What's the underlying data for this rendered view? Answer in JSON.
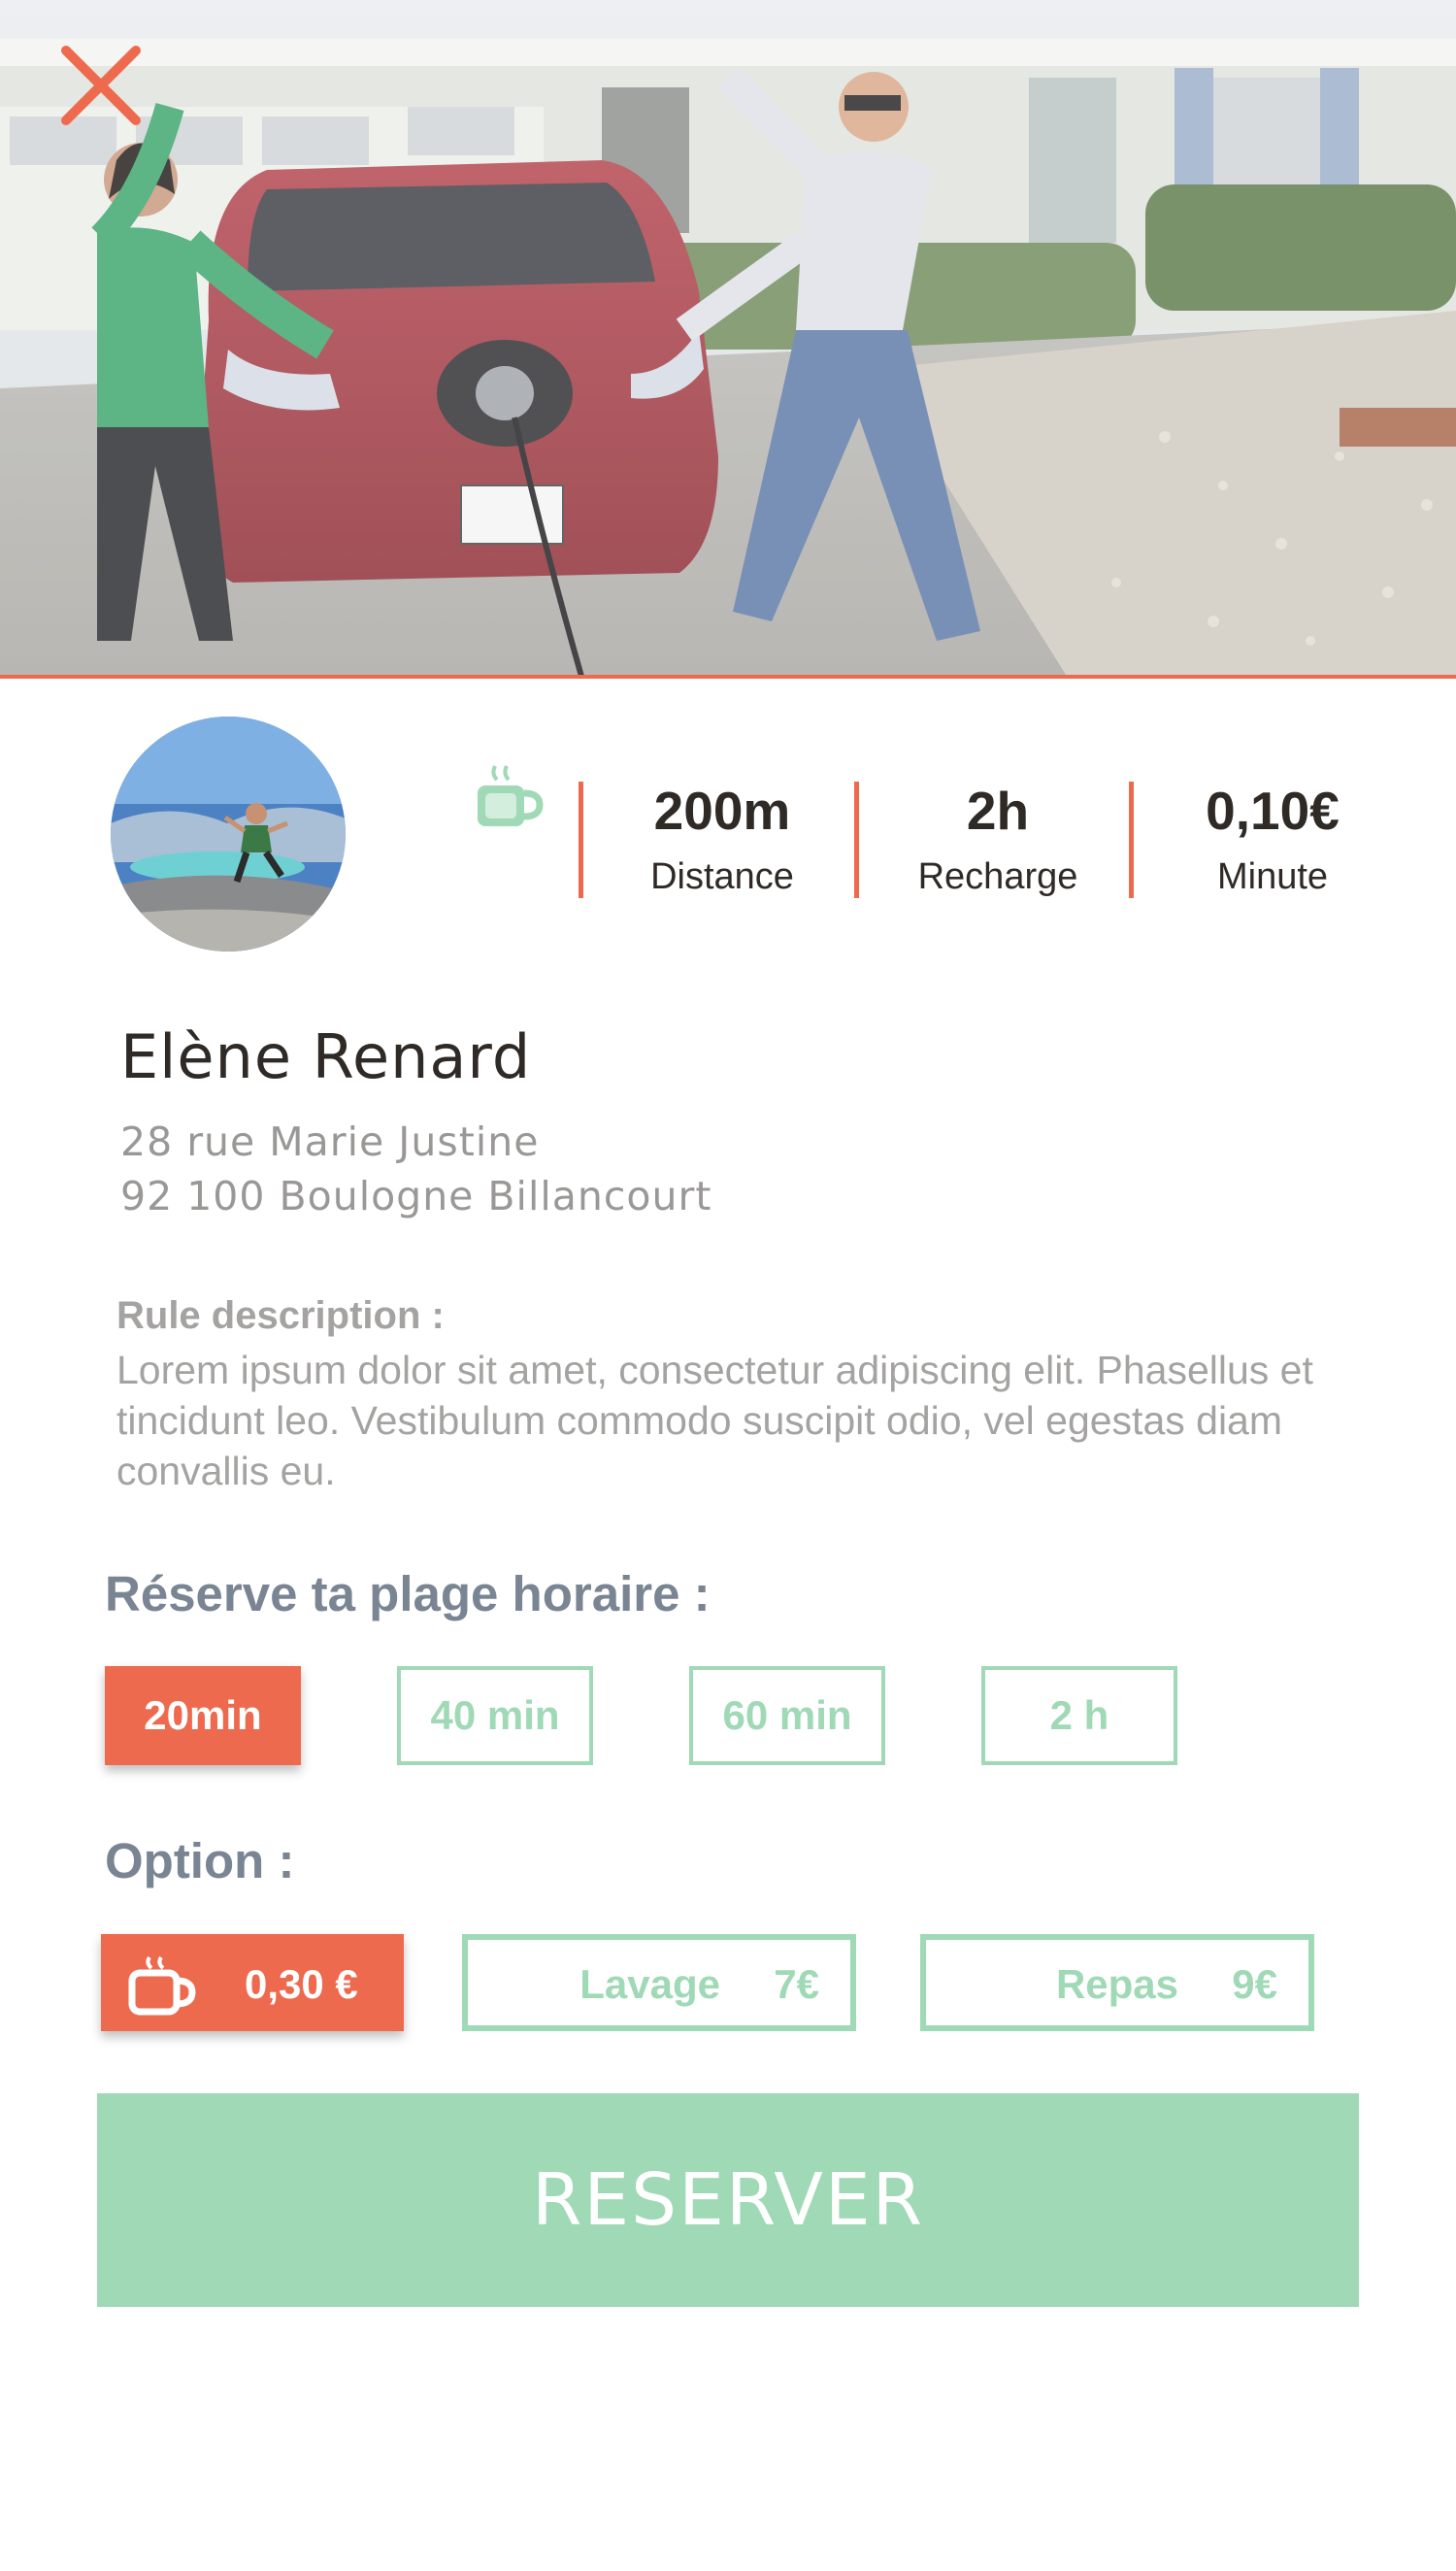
{
  "header": {
    "close_icon": "close-icon",
    "photo": "electric-car-charging-photo"
  },
  "colors": {
    "accent": "#ee6a4e",
    "green": "#9fd9b5",
    "text_dark": "#2f2a26",
    "text_muted": "#a4a3a2",
    "section_title": "#7a8594"
  },
  "host": {
    "avatar": "host-avatar-photo",
    "amenity_icon": "coffee-cup-icon",
    "name": "Elène Renard",
    "address_line1": "28 rue Marie Justine",
    "address_line2": "92 100 Boulogne Billancourt"
  },
  "stats": [
    {
      "value": "200m",
      "label": "Distance"
    },
    {
      "value": "2h",
      "label": "Recharge"
    },
    {
      "value": "0,10€",
      "label": "Minute"
    }
  ],
  "rules": {
    "title": "Rule description :",
    "text": "Lorem ipsum dolor sit amet, consectetur adipiscing elit. Phasellus et tincidunt leo. Vestibulum commodo suscipit odio, vel egestas diam convallis eu."
  },
  "slots": {
    "title": "Réserve ta plage horaire :",
    "selected": "20min",
    "options": [
      "20min",
      "40 min",
      "60 min",
      "2 h"
    ]
  },
  "options": {
    "title": "Option :",
    "coffee": {
      "icon": "coffee-cup-icon",
      "price": "0,30 €",
      "selected": true
    },
    "wash": {
      "label": "Lavage",
      "price": "7€",
      "selected": false
    },
    "meal": {
      "label": "Repas",
      "price": "9€",
      "selected": false
    }
  },
  "cta": {
    "label": "RESERVER"
  }
}
